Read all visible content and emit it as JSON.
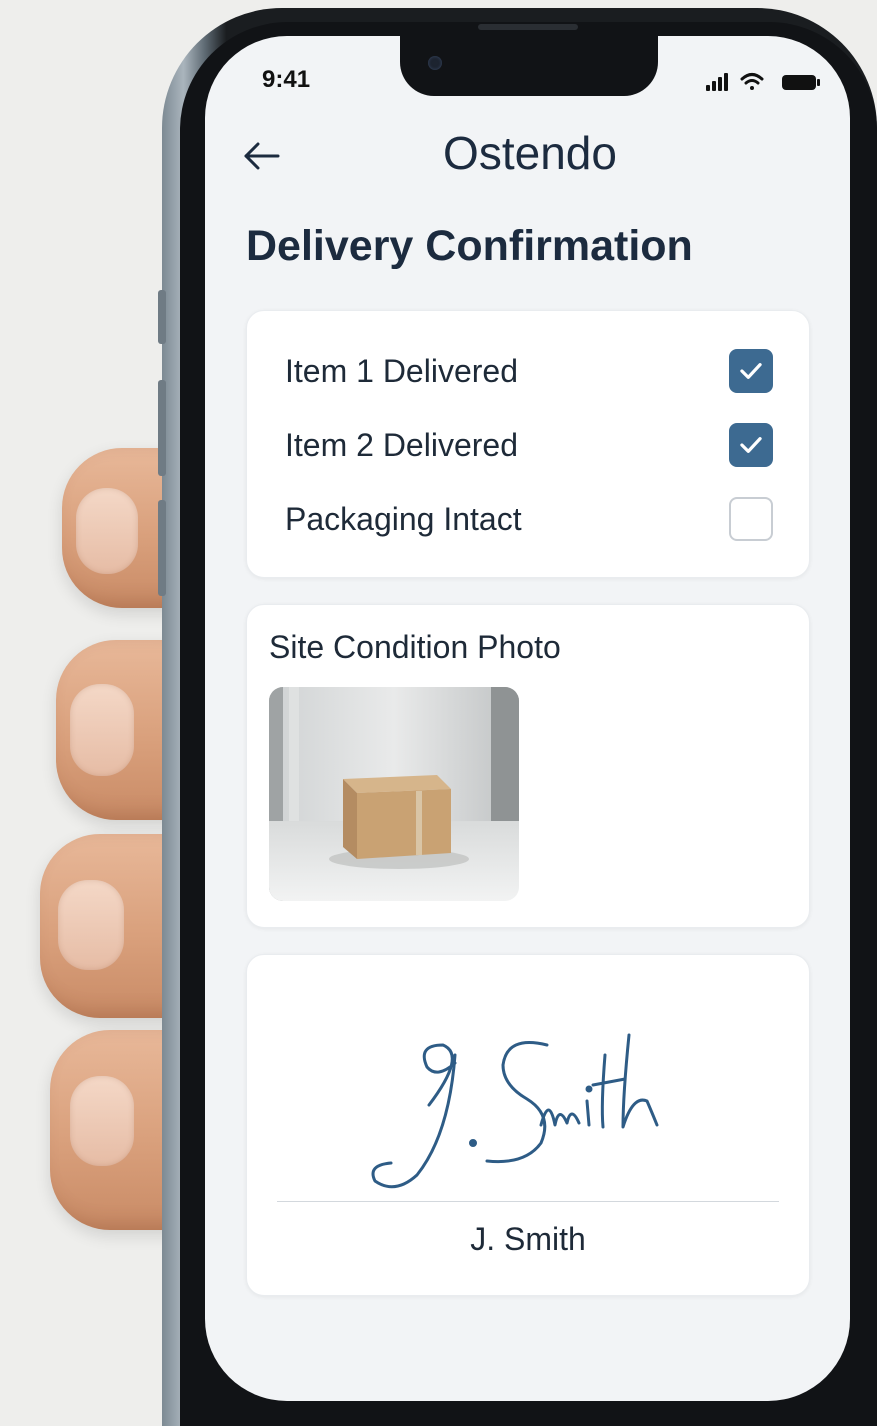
{
  "status_bar": {
    "time": "9:41"
  },
  "header": {
    "app_title": "Ostendo",
    "back_icon": "arrow-left-icon"
  },
  "page_title": "Delivery Confirmation",
  "checklist": {
    "items": [
      {
        "label": "Item 1 Delivered",
        "checked": true
      },
      {
        "label": "Item 2 Delivered",
        "checked": true
      },
      {
        "label": "Packaging Intact",
        "checked": false
      }
    ]
  },
  "photo_section": {
    "heading": "Site Condition Photo"
  },
  "signature_section": {
    "signature_script": "J. Smith",
    "printed_name": "J. Smith"
  },
  "colors": {
    "accent": "#3d6a91",
    "title": "#1c2b3f",
    "screen_bg": "#f2f4f6",
    "signature_ink": "#2e5c86"
  }
}
